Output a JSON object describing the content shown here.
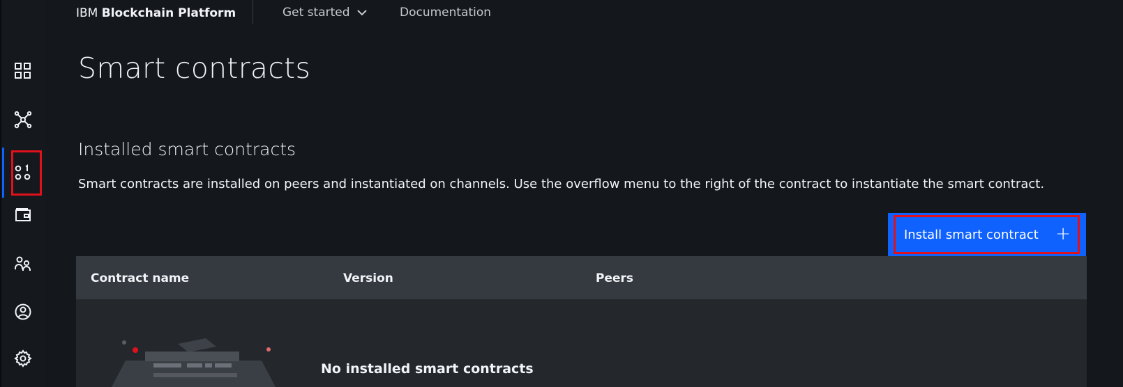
{
  "header": {
    "brand_prefix": "IBM",
    "brand_name": "Blockchain Platform",
    "nav": [
      {
        "label": "Get started",
        "has_dropdown": true
      },
      {
        "label": "Documentation"
      }
    ]
  },
  "sidebar": {
    "items": [
      {
        "icon": "dashboard-grid-icon"
      },
      {
        "icon": "network-nodes-icon"
      },
      {
        "icon": "smart-contracts-icon",
        "active": true
      },
      {
        "icon": "wallet-icon"
      },
      {
        "icon": "users-icon"
      },
      {
        "icon": "user-profile-icon"
      },
      {
        "icon": "settings-gear-icon"
      }
    ]
  },
  "page": {
    "title": "Smart contracts",
    "section_title": "Installed smart contracts",
    "section_description": "Smart contracts are installed on peers and instantiated on channels. Use the overflow menu to the right of the contract to instantiate the smart contract."
  },
  "install_button": {
    "label": "Install smart contract",
    "icon": "plus-icon"
  },
  "table": {
    "columns": [
      "Contract name",
      "Version",
      "Peers"
    ],
    "empty_message": "No installed smart contracts"
  },
  "colors": {
    "background": "#14171b",
    "accent": "#0f62fe",
    "highlight": "#e0111b",
    "table_header": "#353a40"
  }
}
